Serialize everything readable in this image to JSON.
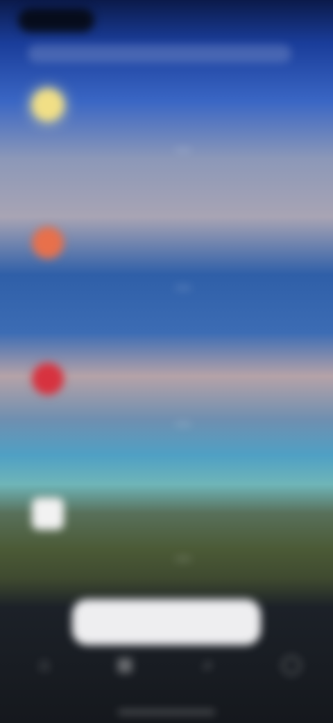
{
  "status_bar": {
    "pill_text": "",
    "right_text": ""
  },
  "cards": [
    {
      "icon": "sun-icon",
      "title": "",
      "subtitle": "",
      "left_text": "",
      "right_text": ""
    },
    {
      "icon": "circle-orange-icon",
      "title": "",
      "subtitle": "",
      "left_text": "",
      "right_text": ""
    },
    {
      "icon": "circle-red-icon",
      "title": "",
      "subtitle": "",
      "left_text": "",
      "right_text": ""
    },
    {
      "icon": "square-white-icon",
      "title": "",
      "subtitle": "",
      "left_text": "",
      "right_text": ""
    }
  ],
  "cta": {
    "label": ""
  },
  "tabbar": {
    "tabs": [
      {
        "icon": "home-icon",
        "label": ""
      },
      {
        "icon": "grid-icon",
        "label": ""
      },
      {
        "icon": "search-icon",
        "label": ""
      },
      {
        "icon": "profile-icon",
        "label": ""
      }
    ]
  },
  "colors": {
    "sun": "#f1df86",
    "orange": "#e8704b",
    "red": "#d7323f",
    "button": "#eeeef0"
  }
}
